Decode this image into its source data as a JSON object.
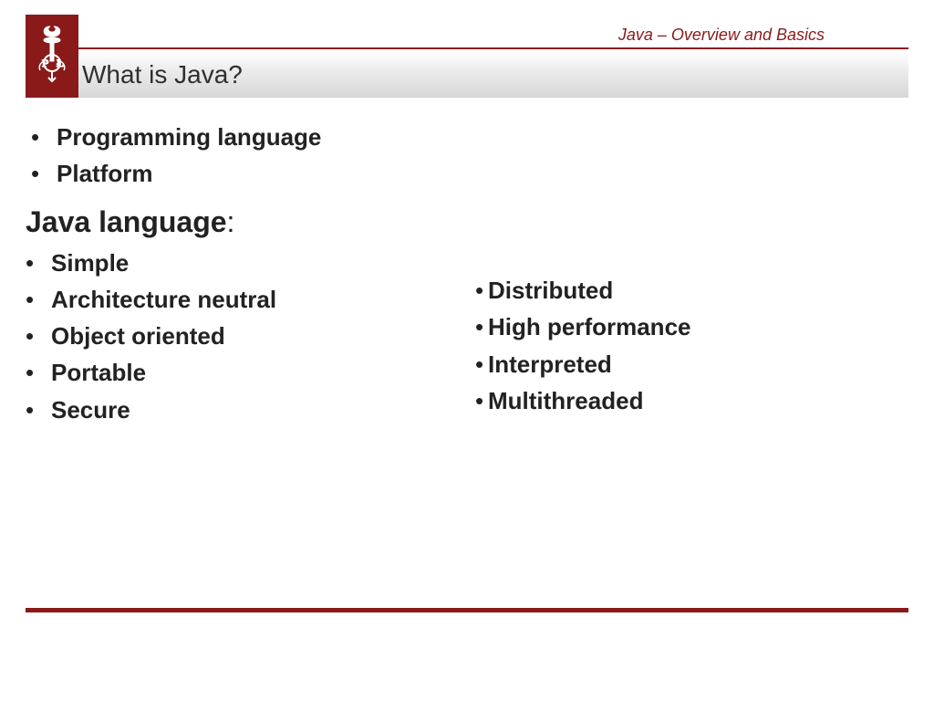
{
  "header": {
    "label": "Java – Overview and Basics"
  },
  "title": "What is Java?",
  "intro_items": [
    "Programming language",
    "Platform"
  ],
  "section_heading": "Java language",
  "features_left": [
    "Simple",
    "Architecture neutral",
    "Object oriented",
    "Portable",
    "Secure"
  ],
  "features_right": [
    "Distributed",
    "High performance",
    "Interpreted",
    "Multithreaded"
  ]
}
